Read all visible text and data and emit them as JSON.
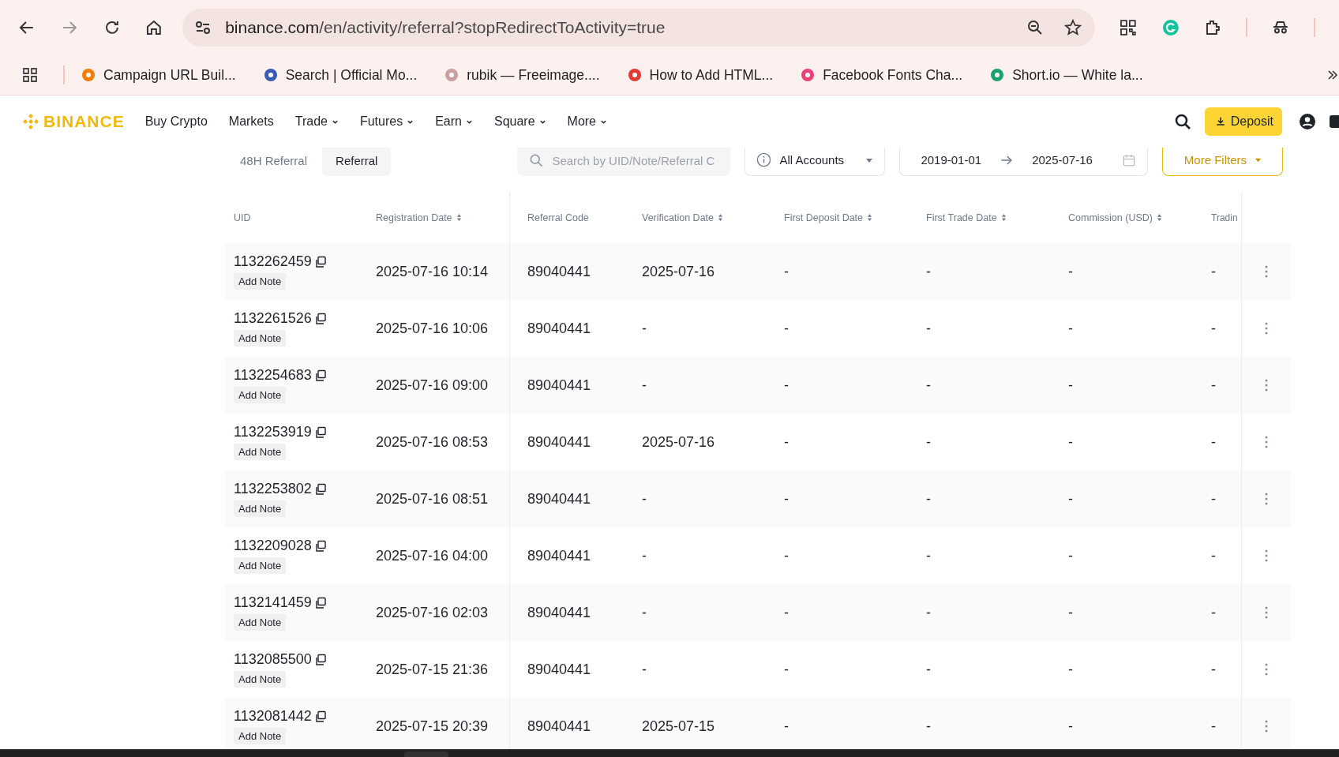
{
  "browser": {
    "url_domain": "binance.com",
    "url_path": "/en/activity/referral?stopRedirectToActivity=true",
    "bookmarks": [
      {
        "title": "Campaign URL Buil..."
      },
      {
        "title": "Search | Official Mo..."
      },
      {
        "title": "rubik — Freeimage...."
      },
      {
        "title": "How to Add HTML..."
      },
      {
        "title": "Facebook Fonts Cha..."
      },
      {
        "title": "Short.io — White la..."
      }
    ]
  },
  "nav": {
    "logo": "BINANCE",
    "items": [
      {
        "label": "Buy Crypto",
        "dropdown": false
      },
      {
        "label": "Markets",
        "dropdown": false
      },
      {
        "label": "Trade",
        "dropdown": true
      },
      {
        "label": "Futures",
        "dropdown": true
      },
      {
        "label": "Earn",
        "dropdown": true
      },
      {
        "label": "Square",
        "dropdown": true
      },
      {
        "label": "More",
        "dropdown": true
      }
    ],
    "deposit": "Deposit"
  },
  "filters": {
    "tabs": [
      {
        "label": "48H Referral",
        "selected": false
      },
      {
        "label": "Referral",
        "selected": true
      }
    ],
    "search": {
      "placeholder": "Search by UID/Note/Referral C"
    },
    "account": "All Accounts",
    "date_from": "2019-01-01",
    "date_to": "2025-07-16",
    "more_filters": "More Filters"
  },
  "table": {
    "columns": [
      {
        "label": "UID",
        "sortable": false
      },
      {
        "label": "Registration Date",
        "sortable": true
      },
      {
        "label": "Referral Code",
        "sortable": false
      },
      {
        "label": "Verification Date",
        "sortable": true
      },
      {
        "label": "First Deposit Date",
        "sortable": true
      },
      {
        "label": "First Trade Date",
        "sortable": true
      },
      {
        "label": "Commission (USD)",
        "sortable": true
      },
      {
        "label": "Tradin",
        "sortable": false
      }
    ],
    "rows": [
      {
        "uid": "1132262459",
        "note": "Add Note",
        "registration_date": "2025-07-16 10:14",
        "referral_code": "89040441",
        "verification_date": "2025-07-16",
        "first_deposit_date": "-",
        "first_trade_date": "-",
        "commission": "-",
        "trading": "-"
      },
      {
        "uid": "1132261526",
        "note": "Add Note",
        "registration_date": "2025-07-16 10:06",
        "referral_code": "89040441",
        "verification_date": "-",
        "first_deposit_date": "-",
        "first_trade_date": "-",
        "commission": "-",
        "trading": "-"
      },
      {
        "uid": "1132254683",
        "note": "Add Note",
        "registration_date": "2025-07-16 09:00",
        "referral_code": "89040441",
        "verification_date": "-",
        "first_deposit_date": "-",
        "first_trade_date": "-",
        "commission": "-",
        "trading": "-"
      },
      {
        "uid": "1132253919",
        "note": "Add Note",
        "registration_date": "2025-07-16 08:53",
        "referral_code": "89040441",
        "verification_date": "2025-07-16",
        "first_deposit_date": "-",
        "first_trade_date": "-",
        "commission": "-",
        "trading": "-"
      },
      {
        "uid": "1132253802",
        "note": "Add Note",
        "registration_date": "2025-07-16 08:51",
        "referral_code": "89040441",
        "verification_date": "-",
        "first_deposit_date": "-",
        "first_trade_date": "-",
        "commission": "-",
        "trading": "-"
      },
      {
        "uid": "1132209028",
        "note": "Add Note",
        "registration_date": "2025-07-16 04:00",
        "referral_code": "89040441",
        "verification_date": "-",
        "first_deposit_date": "-",
        "first_trade_date": "-",
        "commission": "-",
        "trading": "-"
      },
      {
        "uid": "1132141459",
        "note": "Add Note",
        "registration_date": "2025-07-16 02:03",
        "referral_code": "89040441",
        "verification_date": "-",
        "first_deposit_date": "-",
        "first_trade_date": "-",
        "commission": "-",
        "trading": "-"
      },
      {
        "uid": "1132085500",
        "note": "Add Note",
        "registration_date": "2025-07-15 21:36",
        "referral_code": "89040441",
        "verification_date": "-",
        "first_deposit_date": "-",
        "first_trade_date": "-",
        "commission": "-",
        "trading": "-"
      },
      {
        "uid": "1132081442",
        "note": "Add Note",
        "registration_date": "2025-07-15 20:39",
        "referral_code": "89040441",
        "verification_date": "2025-07-15",
        "first_deposit_date": "-",
        "first_trade_date": "-",
        "commission": "-",
        "trading": "-"
      }
    ]
  }
}
